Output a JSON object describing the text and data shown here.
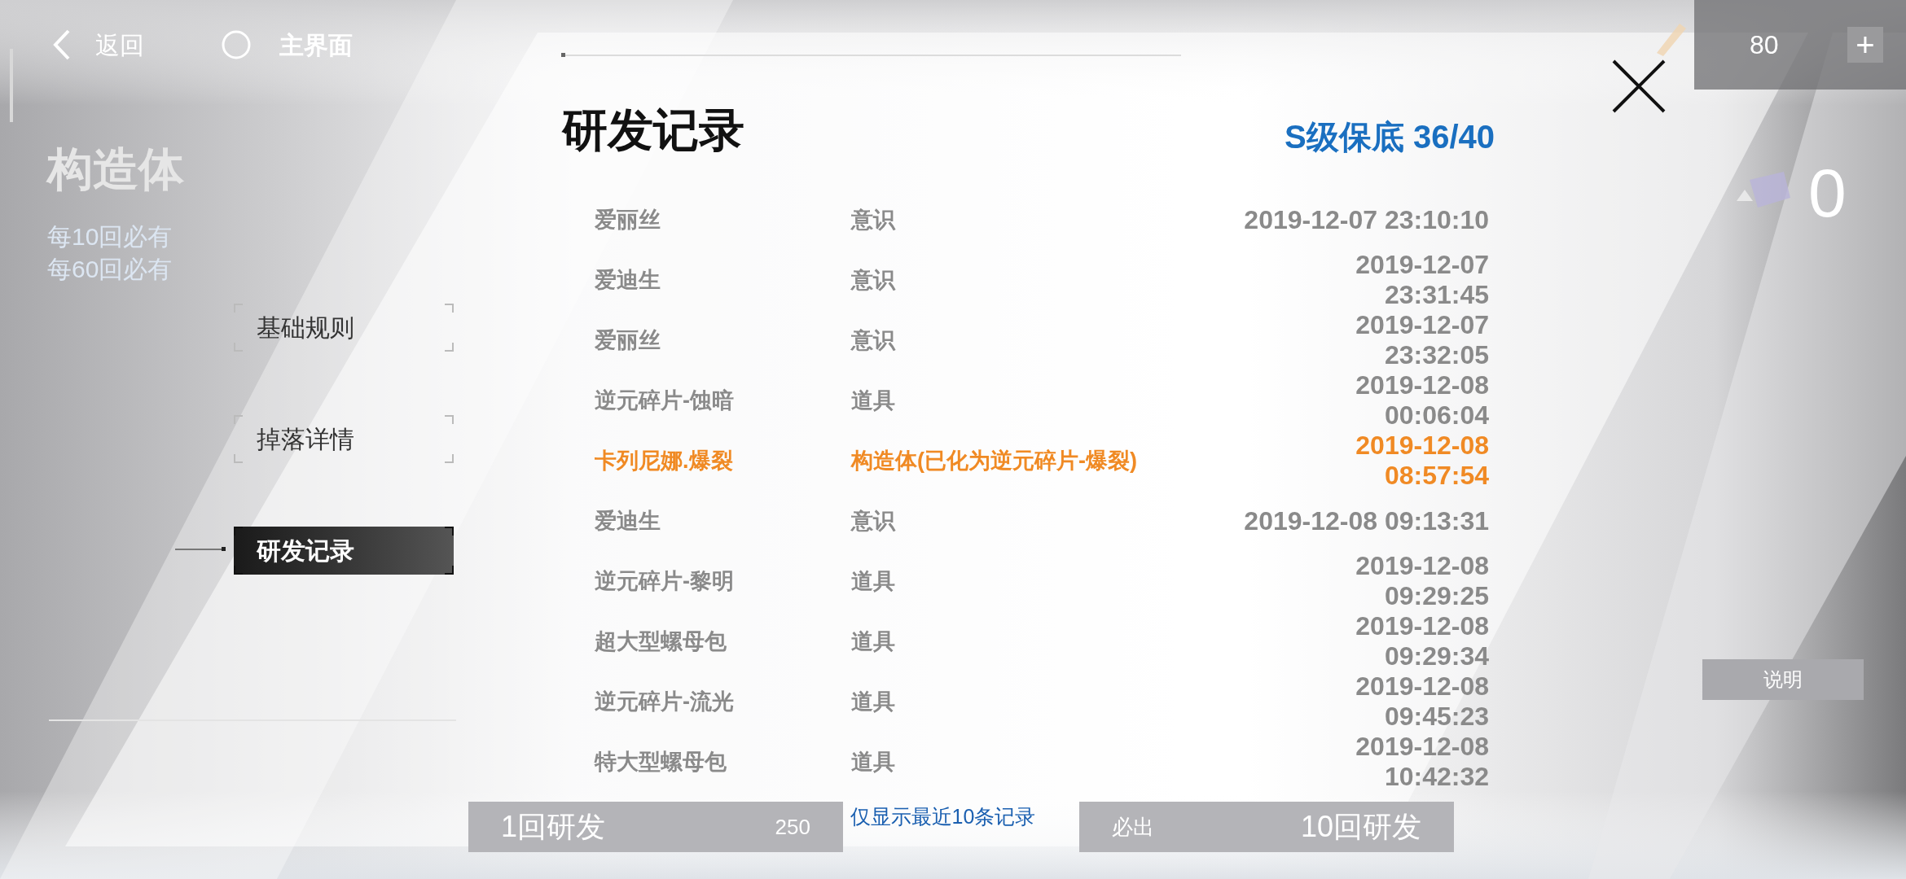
{
  "top_bar": {
    "back": {
      "label": "返回"
    },
    "home": {
      "label": "主界面"
    },
    "currency": {
      "amount": "80"
    },
    "add_symbol": "+"
  },
  "background": {
    "title": "构造体",
    "lines": [
      "每10回必有",
      "每60回必有"
    ],
    "counter": "0",
    "help_button": "说明",
    "pull_buttons": [
      {
        "label": "1回研发",
        "cost": "250"
      },
      {
        "label": "10回研发",
        "note": "必出"
      }
    ]
  },
  "menu": [
    {
      "label": "基础规则",
      "selected": false
    },
    {
      "label": "掉落详情",
      "selected": false
    },
    {
      "label": "研发记录",
      "selected": true
    }
  ],
  "dialog": {
    "title": "研发记录",
    "pity": "S级保底 36/40",
    "rows": [
      {
        "name": "爱丽丝",
        "type": "意识",
        "time": "2019-12-07 23:10:10",
        "highlighted": false
      },
      {
        "name": "爱迪生",
        "type": "意识",
        "time": "2019-12-07\n23:31:45",
        "highlighted": false
      },
      {
        "name": "爱丽丝",
        "type": "意识",
        "time": "2019-12-07\n23:32:05",
        "highlighted": false
      },
      {
        "name": "逆元碎片-蚀暗",
        "type": "道具",
        "time": "2019-12-08\n00:06:04",
        "highlighted": false
      },
      {
        "name": "卡列尼娜.爆裂",
        "type": "构造体(已化为逆元碎片-爆裂)",
        "time": "2019-12-08\n08:57:54",
        "highlighted": true
      },
      {
        "name": "爱迪生",
        "type": "意识",
        "time": "2019-12-08 09:13:31",
        "highlighted": false
      },
      {
        "name": "逆元碎片-黎明",
        "type": "道具",
        "time": "2019-12-08\n09:29:25",
        "highlighted": false
      },
      {
        "name": "超大型螺母包",
        "type": "道具",
        "time": "2019-12-08\n09:29:34",
        "highlighted": false
      },
      {
        "name": "逆元碎片-流光",
        "type": "道具",
        "time": "2019-12-08\n09:45:23",
        "highlighted": false
      },
      {
        "name": "特大型螺母包",
        "type": "道具",
        "time": "2019-12-08\n10:42:32",
        "highlighted": false
      }
    ],
    "footer": "仅显示最近10条记录"
  }
}
